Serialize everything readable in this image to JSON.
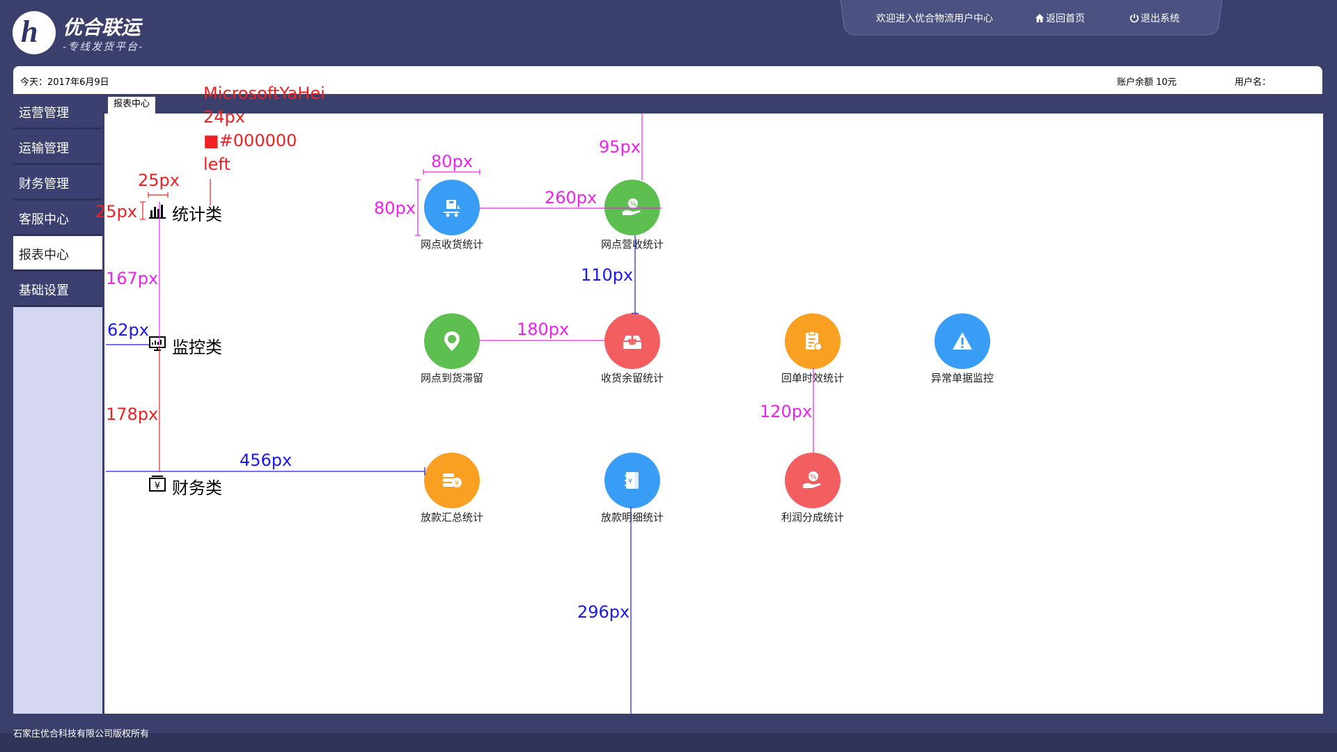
{
  "brand": {
    "title": "优合联运",
    "subtitle": "-专线发货平台-"
  },
  "topnav": {
    "welcome": "欢迎进入优合物流用户中心",
    "home": "返回首页",
    "logout": "退出系统"
  },
  "infobar": {
    "today": "今天：2017年6月9日",
    "balance": "账户余额 10元",
    "user": "用户名："
  },
  "sidebar": {
    "items": [
      {
        "label": "运营管理"
      },
      {
        "label": "运输管理"
      },
      {
        "label": "财务管理"
      },
      {
        "label": "客服中心"
      },
      {
        "label": "报表中心",
        "active": true
      },
      {
        "label": "基础设置"
      }
    ]
  },
  "tab": {
    "label": "报表中心"
  },
  "categories": {
    "stats": "统计类",
    "monitor": "监控类",
    "finance": "财务类"
  },
  "tiles": {
    "shipments": {
      "label": "网点收货统计",
      "color": "#3a9df5",
      "icon": "truck-box-icon"
    },
    "revenue": {
      "label": "网点营收统计",
      "color": "#5cbf4f",
      "icon": "hand-coin-icon"
    },
    "stranded": {
      "label": "网点到货滞留",
      "color": "#5cbf4f",
      "icon": "location-pin-icon"
    },
    "remaining": {
      "label": "收货余留统计",
      "color": "#f35f61",
      "icon": "inbox-icon"
    },
    "receipt": {
      "label": "回单时效统计",
      "color": "#f9a022",
      "icon": "clipboard-icon"
    },
    "abnormal": {
      "label": "异常单据监控",
      "color": "#3a9df5",
      "icon": "warning-icon"
    },
    "loan_summary": {
      "label": "放款汇总统计",
      "color": "#f9a022",
      "icon": "coins-icon"
    },
    "loan_detail": {
      "label": "放款明细统计",
      "color": "#3a9df5",
      "icon": "book-icon"
    },
    "profit": {
      "label": "利润分成统计",
      "color": "#f35f61",
      "icon": "hand-percent-icon"
    }
  },
  "annotations": {
    "font_name": "MicrosoftYaHei",
    "font_size": "24px",
    "font_color": "■#000000",
    "font_align": "left",
    "a25w": "25px",
    "a25h": "25px",
    "a167": "167px",
    "a62": "62px",
    "a178": "178px",
    "a456": "456px",
    "a80w": "80px",
    "a80h": "80px",
    "a95": "95px",
    "a260": "260px",
    "a110": "110px",
    "a180": "180px",
    "a120": "120px",
    "a296": "296px"
  },
  "footer": {
    "copyright": "石家庄优合科技有限公司版权所有"
  }
}
